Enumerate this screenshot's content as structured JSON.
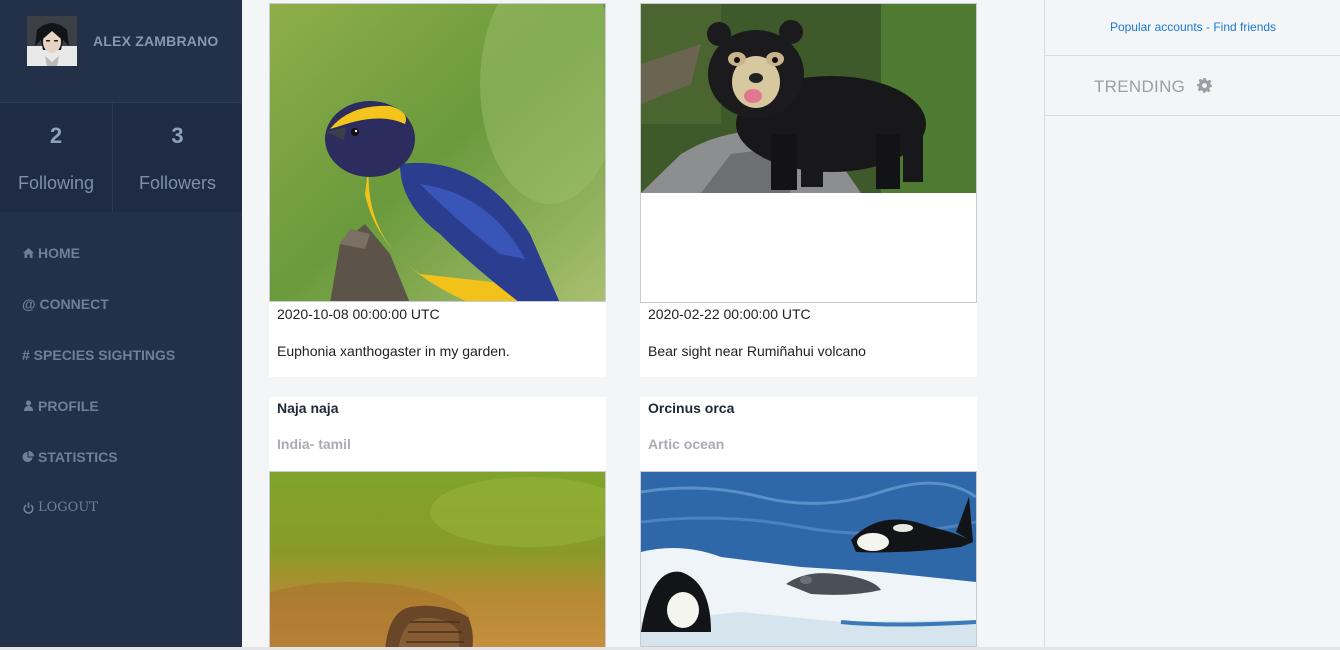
{
  "user": {
    "name": "ALEX ZAMBRANO"
  },
  "stats": {
    "following": {
      "count": "2",
      "label": "Following"
    },
    "followers": {
      "count": "3",
      "label": "Followers"
    }
  },
  "nav": [
    {
      "label": "HOME",
      "icon": "home-icon"
    },
    {
      "label": "@ CONNECT",
      "icon": ""
    },
    {
      "label": "# SPECIES SIGHTINGS",
      "icon": ""
    },
    {
      "label": "PROFILE",
      "icon": "user-icon"
    },
    {
      "label": "STATISTICS",
      "icon": "pie-chart-icon"
    },
    {
      "label": "LOGOUT",
      "icon": "power-icon"
    }
  ],
  "posts": [
    {
      "date": "2020-10-08 00:00:00 UTC",
      "caption": "Euphonia xanthogaster in my garden."
    },
    {
      "date": "2020-02-22 00:00:00 UTC",
      "caption": "Bear sight near Rumiñahui volcano"
    }
  ],
  "sightings": [
    {
      "species": "Naja naja",
      "location": "India- tamil"
    },
    {
      "species": "Orcinus orca",
      "location": "Artic ocean"
    }
  ],
  "right": {
    "popular": "Popular accounts",
    "separator": " - ",
    "find_friends": "Find friends",
    "trending": "TRENDING"
  },
  "colors": {
    "sidebar": "#233148",
    "link": "#1a7ad4",
    "page": "#f4f5f7"
  }
}
